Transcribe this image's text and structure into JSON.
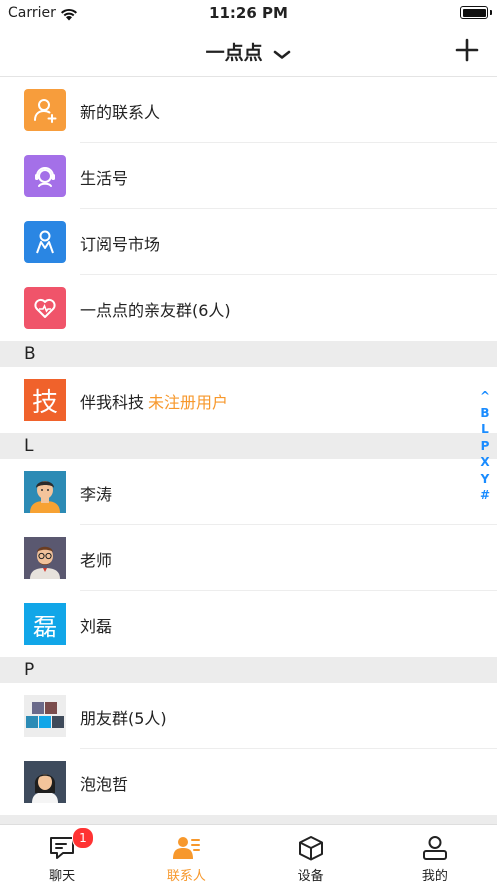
{
  "status_bar": {
    "carrier": "Carrier",
    "time": "11:26 PM"
  },
  "navbar": {
    "title": "一点点"
  },
  "colors": {
    "accent": "#f7982c",
    "index_blue": "#1a8cff",
    "badge_red": "#ff3333"
  },
  "top_items": [
    {
      "label": "新的联系人",
      "icon": "add-person-icon",
      "color": "#f79d3c"
    },
    {
      "label": "生活号",
      "icon": "headset-icon",
      "color": "#a470e8"
    },
    {
      "label": "订阅号市场",
      "icon": "person-outline-icon",
      "color": "#2a86e3"
    },
    {
      "label": "一点点的亲友群(6人)",
      "icon": "heart-icon",
      "color": "#f0546a"
    }
  ],
  "sections": [
    {
      "letter": "B",
      "items": [
        {
          "name": "伴我科技",
          "tag": "未注册用户",
          "avatar_char": "技"
        }
      ]
    },
    {
      "letter": "L",
      "items": [
        {
          "name": "李涛"
        },
        {
          "name": "老师"
        },
        {
          "name": "刘磊",
          "avatar_char": "磊"
        }
      ]
    },
    {
      "letter": "P",
      "items": [
        {
          "name": "朋友群(5人)"
        },
        {
          "name": "泡泡哲"
        }
      ]
    }
  ],
  "index_bar": [
    "^",
    "B",
    "L",
    "P",
    "X",
    "Y",
    "#"
  ],
  "tabbar": {
    "tabs": [
      {
        "label": "聊天",
        "badge": "1"
      },
      {
        "label": "联系人"
      },
      {
        "label": "设备"
      },
      {
        "label": "我的"
      }
    ]
  }
}
